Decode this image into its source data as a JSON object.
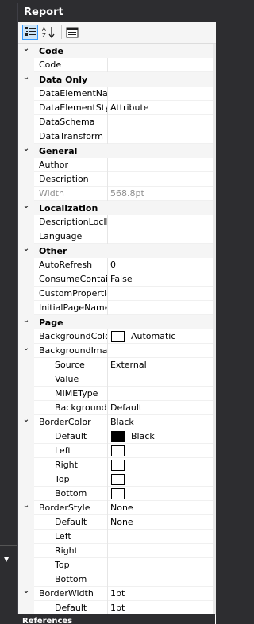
{
  "panel": {
    "title": "Report",
    "footer": "References"
  },
  "toolbar": {
    "categorized_icon": "categorized-view-icon",
    "alphabetical_icon": "alphabetical-sort-icon",
    "pages_icon": "property-pages-icon"
  },
  "rows": [
    {
      "type": "cat",
      "label": "Code"
    },
    {
      "type": "prop",
      "name": "Code",
      "value": ""
    },
    {
      "type": "cat",
      "label": "Data Only"
    },
    {
      "type": "prop",
      "name": "DataElementNam",
      "value": ""
    },
    {
      "type": "prop",
      "name": "DataElementStyle",
      "value": "Attribute"
    },
    {
      "type": "prop",
      "name": "DataSchema",
      "value": ""
    },
    {
      "type": "prop",
      "name": "DataTransform",
      "value": ""
    },
    {
      "type": "cat",
      "label": "General"
    },
    {
      "type": "prop",
      "name": "Author",
      "value": ""
    },
    {
      "type": "prop",
      "name": "Description",
      "value": ""
    },
    {
      "type": "prop",
      "name": "Width",
      "value": "568.8pt",
      "disabled": true
    },
    {
      "type": "cat",
      "label": "Localization"
    },
    {
      "type": "prop",
      "name": "DescriptionLocID",
      "value": ""
    },
    {
      "type": "prop",
      "name": "Language",
      "value": ""
    },
    {
      "type": "cat",
      "label": "Other"
    },
    {
      "type": "prop",
      "name": "AutoRefresh",
      "value": "0"
    },
    {
      "type": "prop",
      "name": "ConsumeContain",
      "value": "False"
    },
    {
      "type": "prop",
      "name": "CustomProperties",
      "value": ""
    },
    {
      "type": "prop",
      "name": "InitialPageName",
      "value": ""
    },
    {
      "type": "cat",
      "label": "Page"
    },
    {
      "type": "prop",
      "name": "BackgroundColor",
      "value": "Automatic",
      "swatch": "white"
    },
    {
      "type": "group",
      "name": "BackgroundImage",
      "value": ""
    },
    {
      "type": "sub",
      "name": "Source",
      "value": "External"
    },
    {
      "type": "sub",
      "name": "Value",
      "value": ""
    },
    {
      "type": "sub",
      "name": "MIMEType",
      "value": ""
    },
    {
      "type": "sub",
      "name": "BackgroundR",
      "value": "Default"
    },
    {
      "type": "group",
      "name": "BorderColor",
      "value": "Black"
    },
    {
      "type": "sub",
      "name": "Default",
      "value": "Black",
      "swatch": "black"
    },
    {
      "type": "sub",
      "name": "Left",
      "value": "",
      "swatch": "white"
    },
    {
      "type": "sub",
      "name": "Right",
      "value": "",
      "swatch": "white"
    },
    {
      "type": "sub",
      "name": "Top",
      "value": "",
      "swatch": "white"
    },
    {
      "type": "sub",
      "name": "Bottom",
      "value": "",
      "swatch": "white"
    },
    {
      "type": "group",
      "name": "BorderStyle",
      "value": "None"
    },
    {
      "type": "sub",
      "name": "Default",
      "value": "None"
    },
    {
      "type": "sub",
      "name": "Left",
      "value": ""
    },
    {
      "type": "sub",
      "name": "Right",
      "value": ""
    },
    {
      "type": "sub",
      "name": "Top",
      "value": ""
    },
    {
      "type": "sub",
      "name": "Bottom",
      "value": ""
    },
    {
      "type": "group",
      "name": "BorderWidth",
      "value": "1pt"
    },
    {
      "type": "sub",
      "name": "Default",
      "value": "1pt"
    }
  ]
}
